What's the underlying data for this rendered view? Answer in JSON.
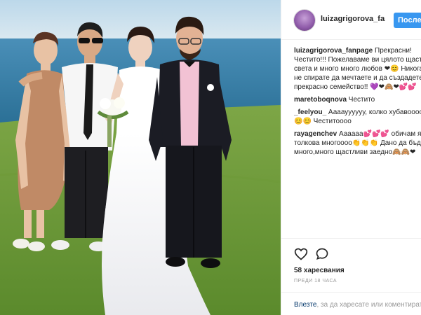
{
  "header": {
    "username": "luizagrigorova_fanpage",
    "follow_label": "Последвай"
  },
  "comments": [
    {
      "user": "luizagrigorova_fanpage",
      "lines": [
        "Прекрасни!",
        "Честито!!! Пожелаваме ви цялото щастие на",
        "света и много много любов ❤😊 Никога",
        "не спирате да мечтаете и да създадете",
        "прекрасно семейство!! 💜❤🙈❤💕💕"
      ]
    },
    {
      "user": "maretoboqnova",
      "lines": [
        "Честито"
      ]
    },
    {
      "user": "_feelyou_",
      "lines": [
        "Аааауууууу, колко хубавоооо",
        "😊😊 Честитоооо"
      ]
    },
    {
      "user": "rayagenchev",
      "lines": [
        "Аааааа💕💕💕 обичам я",
        "толкова многоооо👏👏👏 Дано да бъдете",
        "много,много щастливи заедно🙈🙈❤"
      ]
    }
  ],
  "actions": {
    "like_icon": "heart-icon",
    "comment_icon": "comment-icon",
    "likes_text": "58 харесвания",
    "time_text": "ПРЕДИ 18 ЧАСА"
  },
  "login": {
    "link": "Влезте",
    "rest": ", за да харесате или коментирате."
  },
  "colors": {
    "accent": "#3897f0",
    "sea": "#2f7da3",
    "grass": "#6f9b3a"
  }
}
